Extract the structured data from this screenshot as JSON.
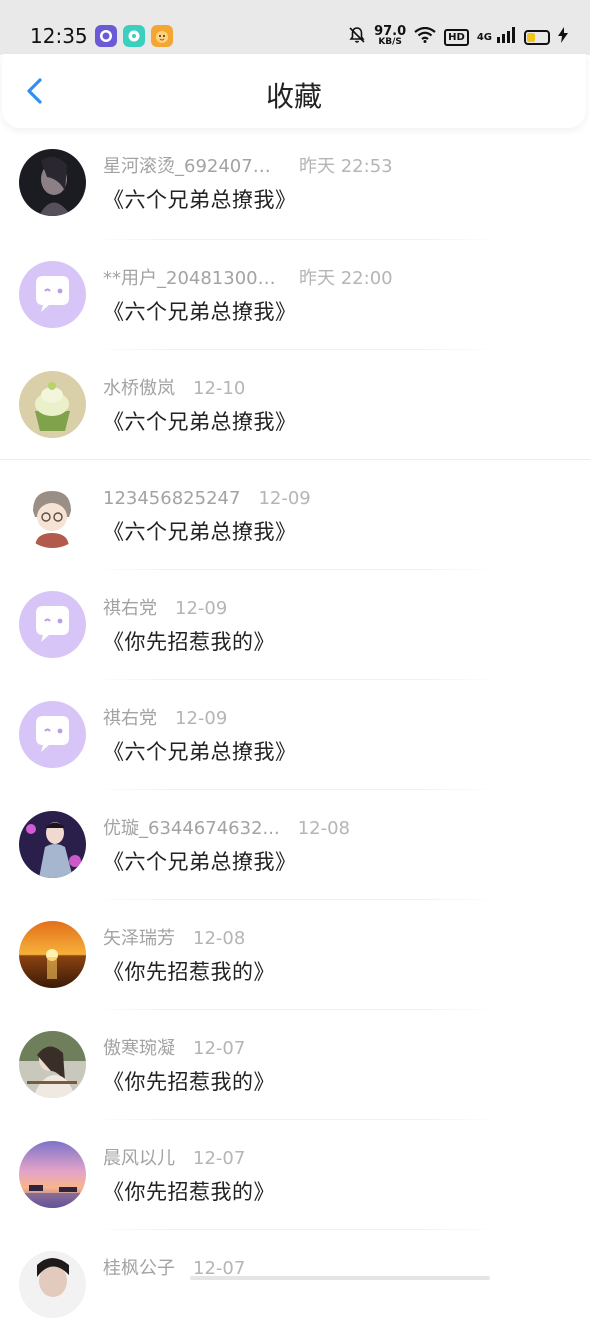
{
  "status_bar": {
    "time": "12:35",
    "net_speed_value": "97.0",
    "net_speed_unit": "KB/S",
    "hd_label": "HD",
    "network_type": "4G",
    "apps": [
      "chat-app-icon",
      "message-app-icon",
      "cartoon-app-icon"
    ],
    "icons": [
      "bell-muted-icon",
      "wifi-icon",
      "signal-icon",
      "battery-icon",
      "charging-icon"
    ]
  },
  "header": {
    "title": "收藏",
    "back_icon": "chevron-left-icon",
    "accent_color": "#2f8ff3"
  },
  "favorites": [
    {
      "name": "星河滚烫_6924070...",
      "time": "昨天 22:53",
      "book": "《六个兄弟总撩我》",
      "avatar": "dark-portrait"
    },
    {
      "name": "**用户_204813003...",
      "time": "昨天 22:00",
      "book": "《六个兄弟总撩我》",
      "avatar": "default-bubble"
    },
    {
      "name": "水桥傲岚",
      "time": "12-10",
      "book": "《六个兄弟总撩我》",
      "avatar": "cupcake"
    },
    {
      "name": "123456825247",
      "time": "12-09",
      "book": "《六个兄弟总撩我》",
      "avatar": "anime-boy"
    },
    {
      "name": "祺右党",
      "time": "12-09",
      "book": "《你先招惹我的》",
      "avatar": "default-bubble"
    },
    {
      "name": "祺右党",
      "time": "12-09",
      "book": "《六个兄弟总撩我》",
      "avatar": "default-bubble"
    },
    {
      "name": "优璇_6344674632...",
      "time": "12-08",
      "book": "《六个兄弟总撩我》",
      "avatar": "stage-portrait"
    },
    {
      "name": "矢泽瑞芳",
      "time": "12-08",
      "book": "《你先招惹我的》",
      "avatar": "sunset-sea"
    },
    {
      "name": "傲寒琬凝",
      "time": "12-07",
      "book": "《你先招惹我的》",
      "avatar": "girl-photo"
    },
    {
      "name": "晨风以儿",
      "time": "12-07",
      "book": "《你先招惹我的》",
      "avatar": "pink-sky"
    },
    {
      "name": "桂枫公子",
      "time": "12-07",
      "book": "",
      "avatar": "dark-portrait"
    }
  ]
}
